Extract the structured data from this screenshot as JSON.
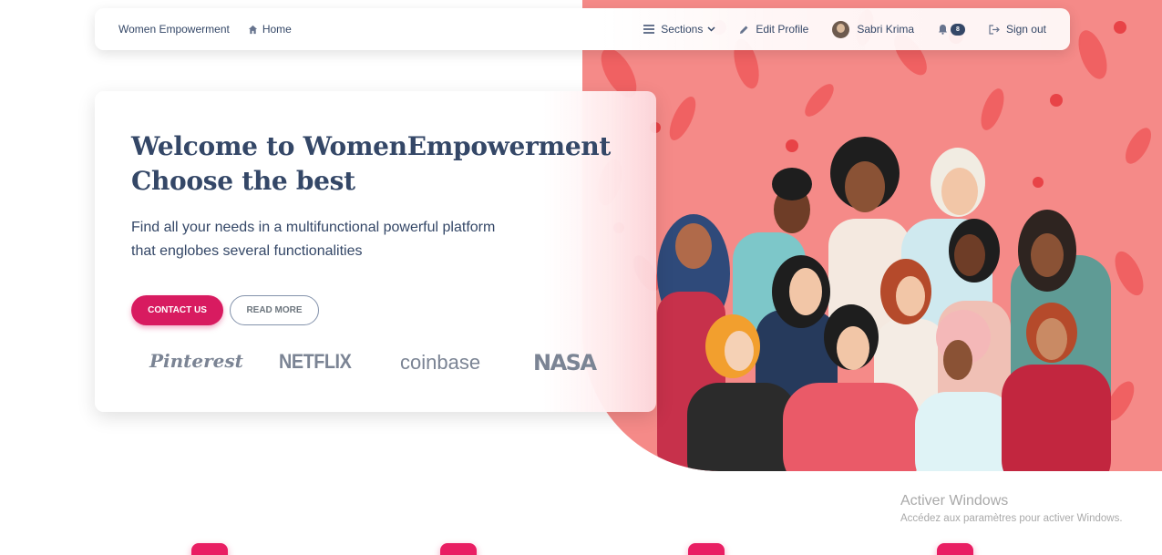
{
  "navbar": {
    "brand": "Women Empowerment",
    "home_label": "Home",
    "sections_label": "Sections",
    "edit_profile_label": "Edit Profile",
    "user_name": "Sabri Krima",
    "notification_count": "8",
    "sign_out_label": "Sign out"
  },
  "hero": {
    "title_line1": "Welcome to WomenEmpowerment",
    "title_line2": "Choose the best",
    "lead_line1": "Find all your needs in a multifunctional powerful platform",
    "lead_line2": "that englobes several functionalities",
    "contact_button": "CONTACT US",
    "read_more_button": "READ MORE",
    "logos": [
      "Pinterest",
      "NETFLIX",
      "coinbase",
      "NASA"
    ]
  },
  "watermark": {
    "title": "Activer Windows",
    "subtitle": "Accédez aux paramètres pour activer Windows."
  },
  "colors": {
    "primary": "#d81b60",
    "text": "#344767",
    "hero_bg": "#f58a88"
  }
}
